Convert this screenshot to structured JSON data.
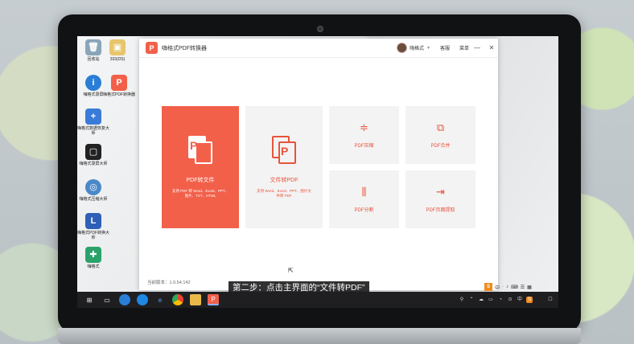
{
  "app": {
    "title": "嗨格式PDF转换器",
    "user_name": "嗨格式",
    "support_label": "客服",
    "menu_label": "菜单",
    "minimize": "—",
    "close": "✕",
    "version_label": "当前版本：1.0.54.142"
  },
  "tiles": [
    {
      "id": "pdf-to-file",
      "label": "PDF转文件",
      "desc": "支持 PDF 转 Word、Excel、PPT、图片、TXT、HTML",
      "icon_letter": "P"
    },
    {
      "id": "file-to-pdf",
      "label": "文件转PDF",
      "desc": "支持 Word、Excel、PPT、图片文件转 PDF",
      "icon_letter": "P"
    },
    {
      "id": "pdf-compress",
      "label": "PDF压缩",
      "icon": "compress-icon",
      "glyph": "≑"
    },
    {
      "id": "pdf-merge",
      "label": "PDF合并",
      "icon": "merge-icon",
      "glyph": "⧉"
    },
    {
      "id": "pdf-split",
      "label": "PDF分割",
      "icon": "split-icon",
      "glyph": "⫼"
    },
    {
      "id": "pdf-extract",
      "label": "PDF页面提取",
      "icon": "extract-icon",
      "glyph": "⇥"
    }
  ],
  "desktop_icons": [
    "回收站",
    "333(DS)",
    "嗨格式录屏",
    "嗨格式PDF转换器",
    "嗨格式数据恢复大师",
    "嗨格式录屏大师",
    "嗨格式压缩大师",
    "嗨格式PDF转换大师",
    "嗨格式"
  ],
  "caption": "第二步：点击主界面的“文件转PDF”",
  "ime": {
    "s": "S",
    "items": [
      "中",
      "·",
      "♪",
      "⌨",
      "☰",
      "▦"
    ]
  },
  "tray": {
    "items": [
      "⌃",
      "☁",
      "▭",
      "◔",
      "⊙",
      "中",
      "S"
    ],
    "time": "",
    "notify": "☐"
  },
  "colors": {
    "accent": "#f2604a",
    "tile_bg": "#f3f3f3"
  }
}
